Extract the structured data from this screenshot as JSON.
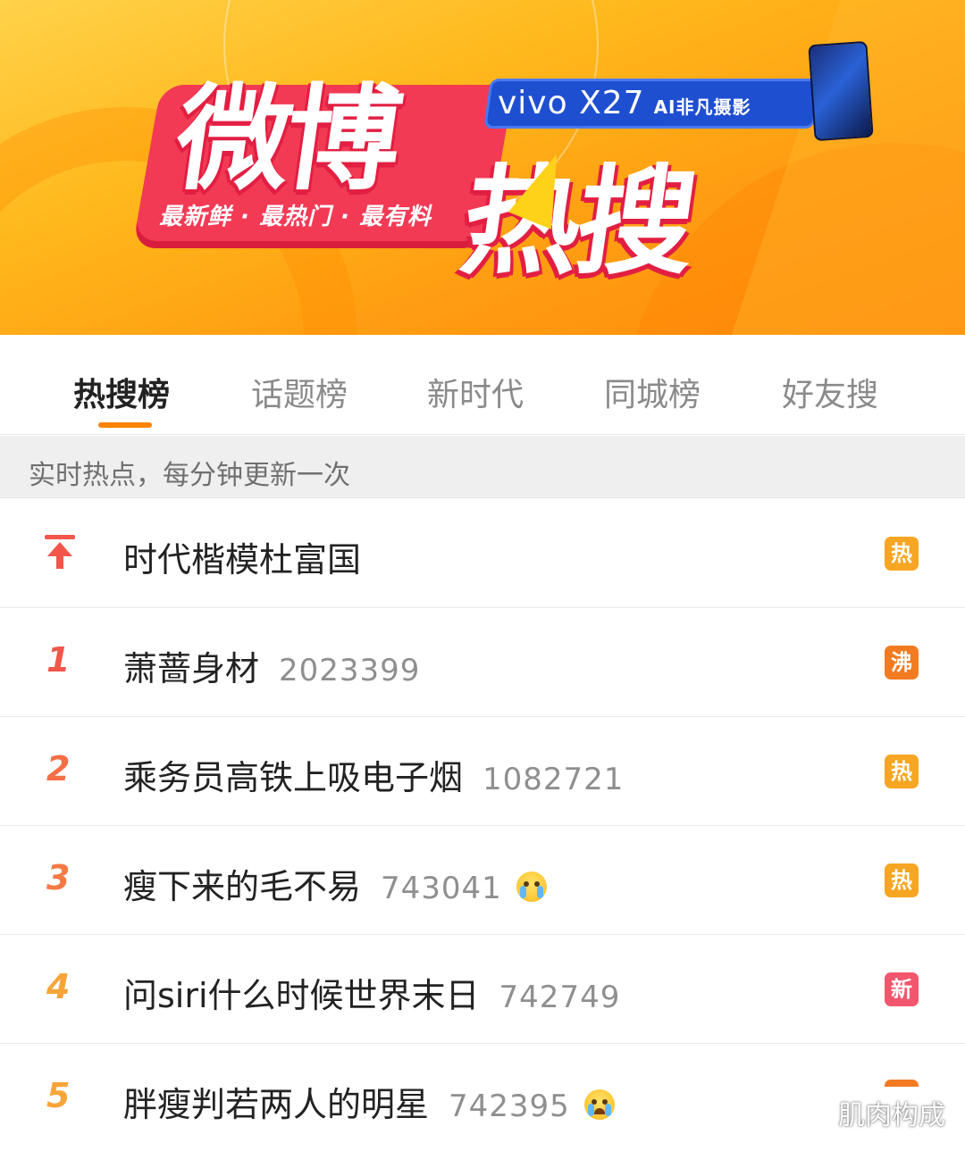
{
  "banner": {
    "title_line1": "微博",
    "title_line2": "热搜",
    "slogan": "最新鲜 · 最热门 · 最有料",
    "ad_brand": "vivo X27",
    "ad_tagline": "AI非凡摄影"
  },
  "tabs": [
    {
      "label": "热搜榜",
      "active": true
    },
    {
      "label": "话题榜",
      "active": false
    },
    {
      "label": "新时代",
      "active": false
    },
    {
      "label": "同城榜",
      "active": false
    },
    {
      "label": "好友搜",
      "active": false
    }
  ],
  "subheader": "实时热点，每分钟更新一次",
  "list": [
    {
      "rank": "",
      "pinned": true,
      "title": "时代楷模杜富国",
      "count": "",
      "emoji": "",
      "badge": "热",
      "badge_color": "#f6a623"
    },
    {
      "rank": "1",
      "title": "萧蔷身材",
      "count": "2023399",
      "emoji": "",
      "badge": "沸",
      "badge_color": "#f27b22"
    },
    {
      "rank": "2",
      "title": "乘务员高铁上吸电子烟",
      "count": "1082721",
      "emoji": "",
      "badge": "热",
      "badge_color": "#f6a623"
    },
    {
      "rank": "3",
      "title": "瘦下来的毛不易",
      "count": "743041",
      "emoji": "crying-face-emoji",
      "badge": "热",
      "badge_color": "#f6a623"
    },
    {
      "rank": "4",
      "title": "问siri什么时候世界末日",
      "count": "742749",
      "emoji": "",
      "badge": "新",
      "badge_color": "#f2566e"
    },
    {
      "rank": "5",
      "title": "胖瘦判若两人的明星",
      "count": "742395",
      "emoji": "laughing-crying-emoji",
      "badge": "",
      "badge_color": "#f27b22"
    }
  ],
  "watermark": "肌肉构成"
}
